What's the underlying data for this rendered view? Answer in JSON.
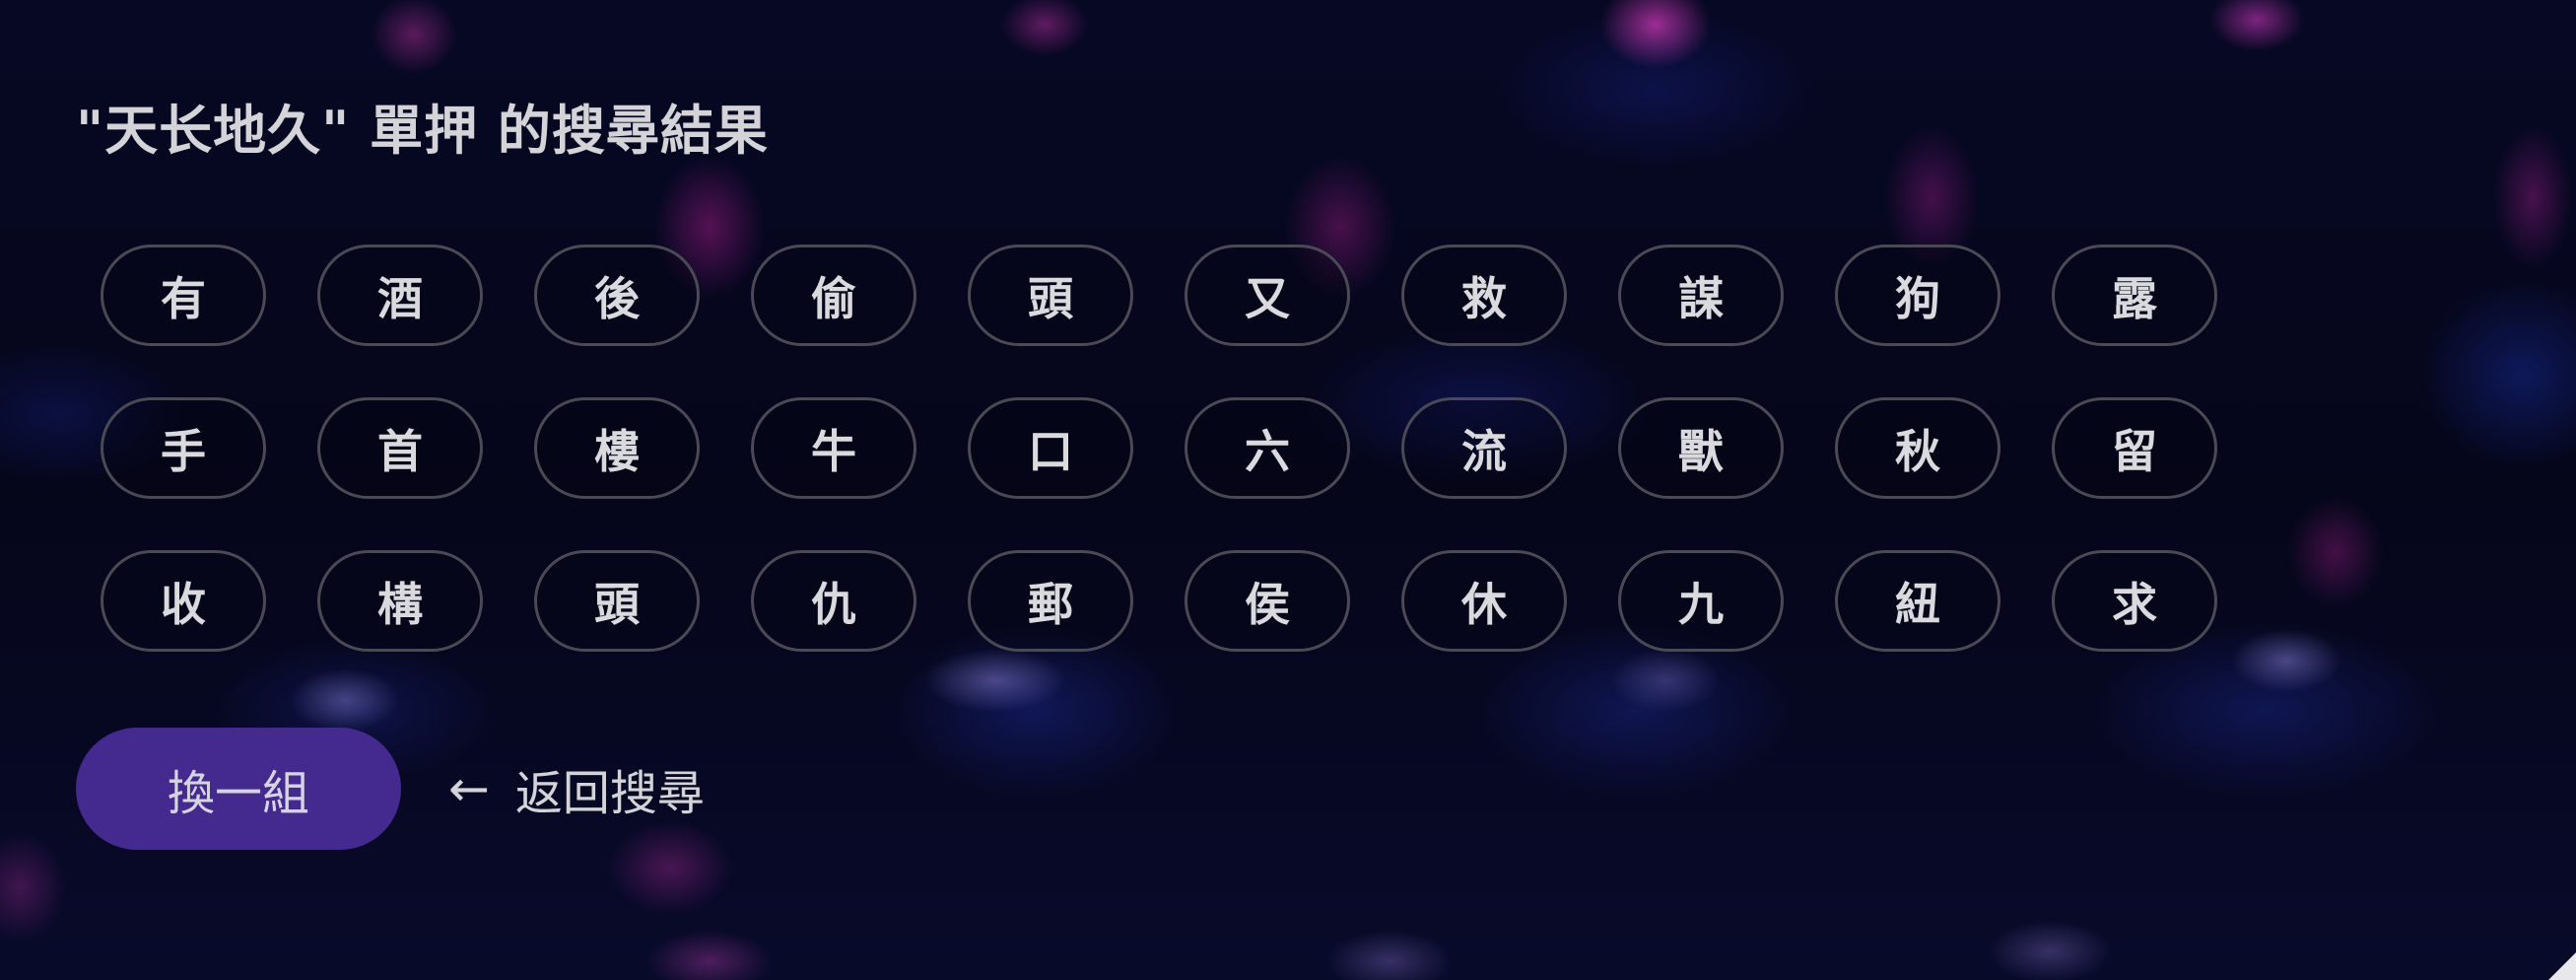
{
  "page": {
    "title": "\"天长地久\" 單押 的搜尋結果"
  },
  "rhymes": [
    "有",
    "酒",
    "後",
    "偷",
    "頭",
    "又",
    "救",
    "謀",
    "狗",
    "露",
    "手",
    "首",
    "樓",
    "牛",
    "口",
    "六",
    "流",
    "獸",
    "秋",
    "留",
    "收",
    "構",
    "頭",
    "仇",
    "郵",
    "侯",
    "休",
    "九",
    "紐",
    "求"
  ],
  "actions": {
    "shuffle_label": "換一組",
    "back_arrow": "←",
    "back_label": "返回搜尋"
  },
  "colors": {
    "accent": "#442a8e",
    "chip_border": "#4a4a55",
    "text": "#d3d3d8",
    "background": "#05061a"
  }
}
